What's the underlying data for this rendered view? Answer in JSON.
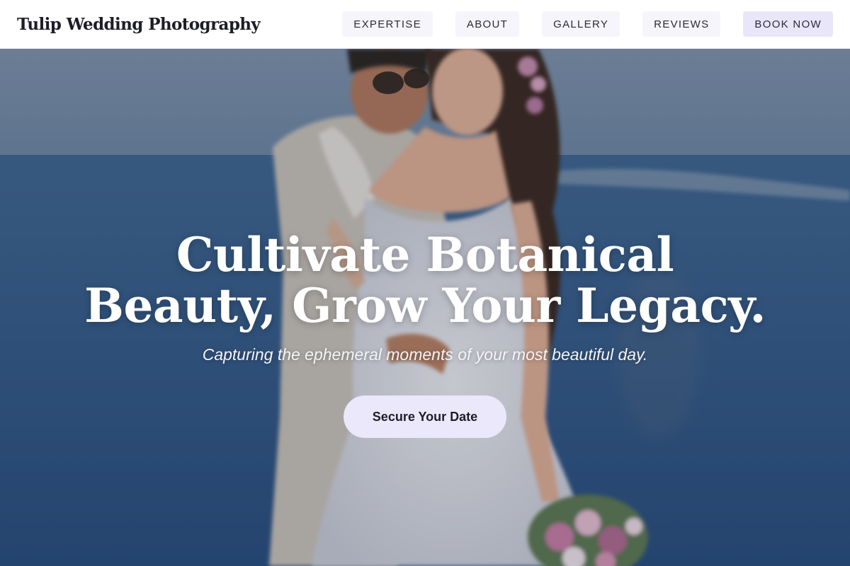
{
  "header": {
    "brand": "Tulip Wedding Photography",
    "nav": [
      {
        "label": "EXPERTISE"
      },
      {
        "label": "ABOUT"
      },
      {
        "label": "GALLERY"
      },
      {
        "label": "REVIEWS"
      },
      {
        "label": "BOOK NOW"
      }
    ]
  },
  "hero": {
    "title_line1": "Cultivate Botanical",
    "title_line2": "Beauty, Grow Your Legacy.",
    "subtitle": "Capturing the ephemeral moments of your most beautiful day.",
    "cta_label": "Secure Your Date",
    "image_alt": "wedding couple photo"
  },
  "colors": {
    "accent": "#e9e6fa",
    "nav_bg": "#f6f5fb",
    "text_dark": "#1d1d28"
  }
}
